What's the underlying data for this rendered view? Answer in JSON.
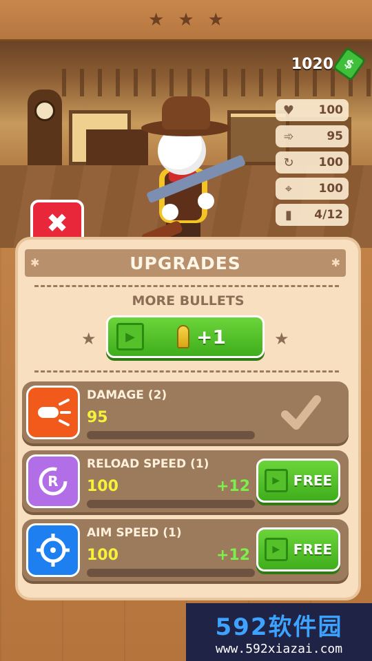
{
  "top_stars": [
    "★",
    "★",
    "★"
  ],
  "money": {
    "value": "1020",
    "icon": "cash-icon"
  },
  "stats": [
    {
      "icon": "heart-icon",
      "glyph": "♥",
      "value": "100"
    },
    {
      "icon": "damage-icon",
      "glyph": "➾",
      "value": "95"
    },
    {
      "icon": "reload-icon",
      "glyph": "↻",
      "value": "100"
    },
    {
      "icon": "crosshair-icon",
      "glyph": "⌖",
      "value": "100"
    },
    {
      "icon": "bullet-icon",
      "glyph": "▮",
      "value": "4/12"
    }
  ],
  "close": {
    "glyph": "✖"
  },
  "panel": {
    "title": "UPGRADES",
    "more_bullets_label": "MORE BULLETS",
    "bullets_button_value": "+1"
  },
  "upgrades": [
    {
      "name": "DAMAGE (2)",
      "value": "95",
      "plus": "",
      "action": "owned",
      "color": "#f25a1c",
      "icon": "damage-icon"
    },
    {
      "name": "RELOAD SPEED (1)",
      "value": "100",
      "plus": "+12",
      "action": "FREE",
      "color": "#b26ee6",
      "icon": "reload-icon"
    },
    {
      "name": "AIM SPEED (1)",
      "value": "100",
      "plus": "+12",
      "action": "FREE",
      "color": "#1e7ff0",
      "icon": "crosshair-icon"
    }
  ],
  "watermark": {
    "title": "592软件园",
    "url": "www.592xiazai.com"
  }
}
